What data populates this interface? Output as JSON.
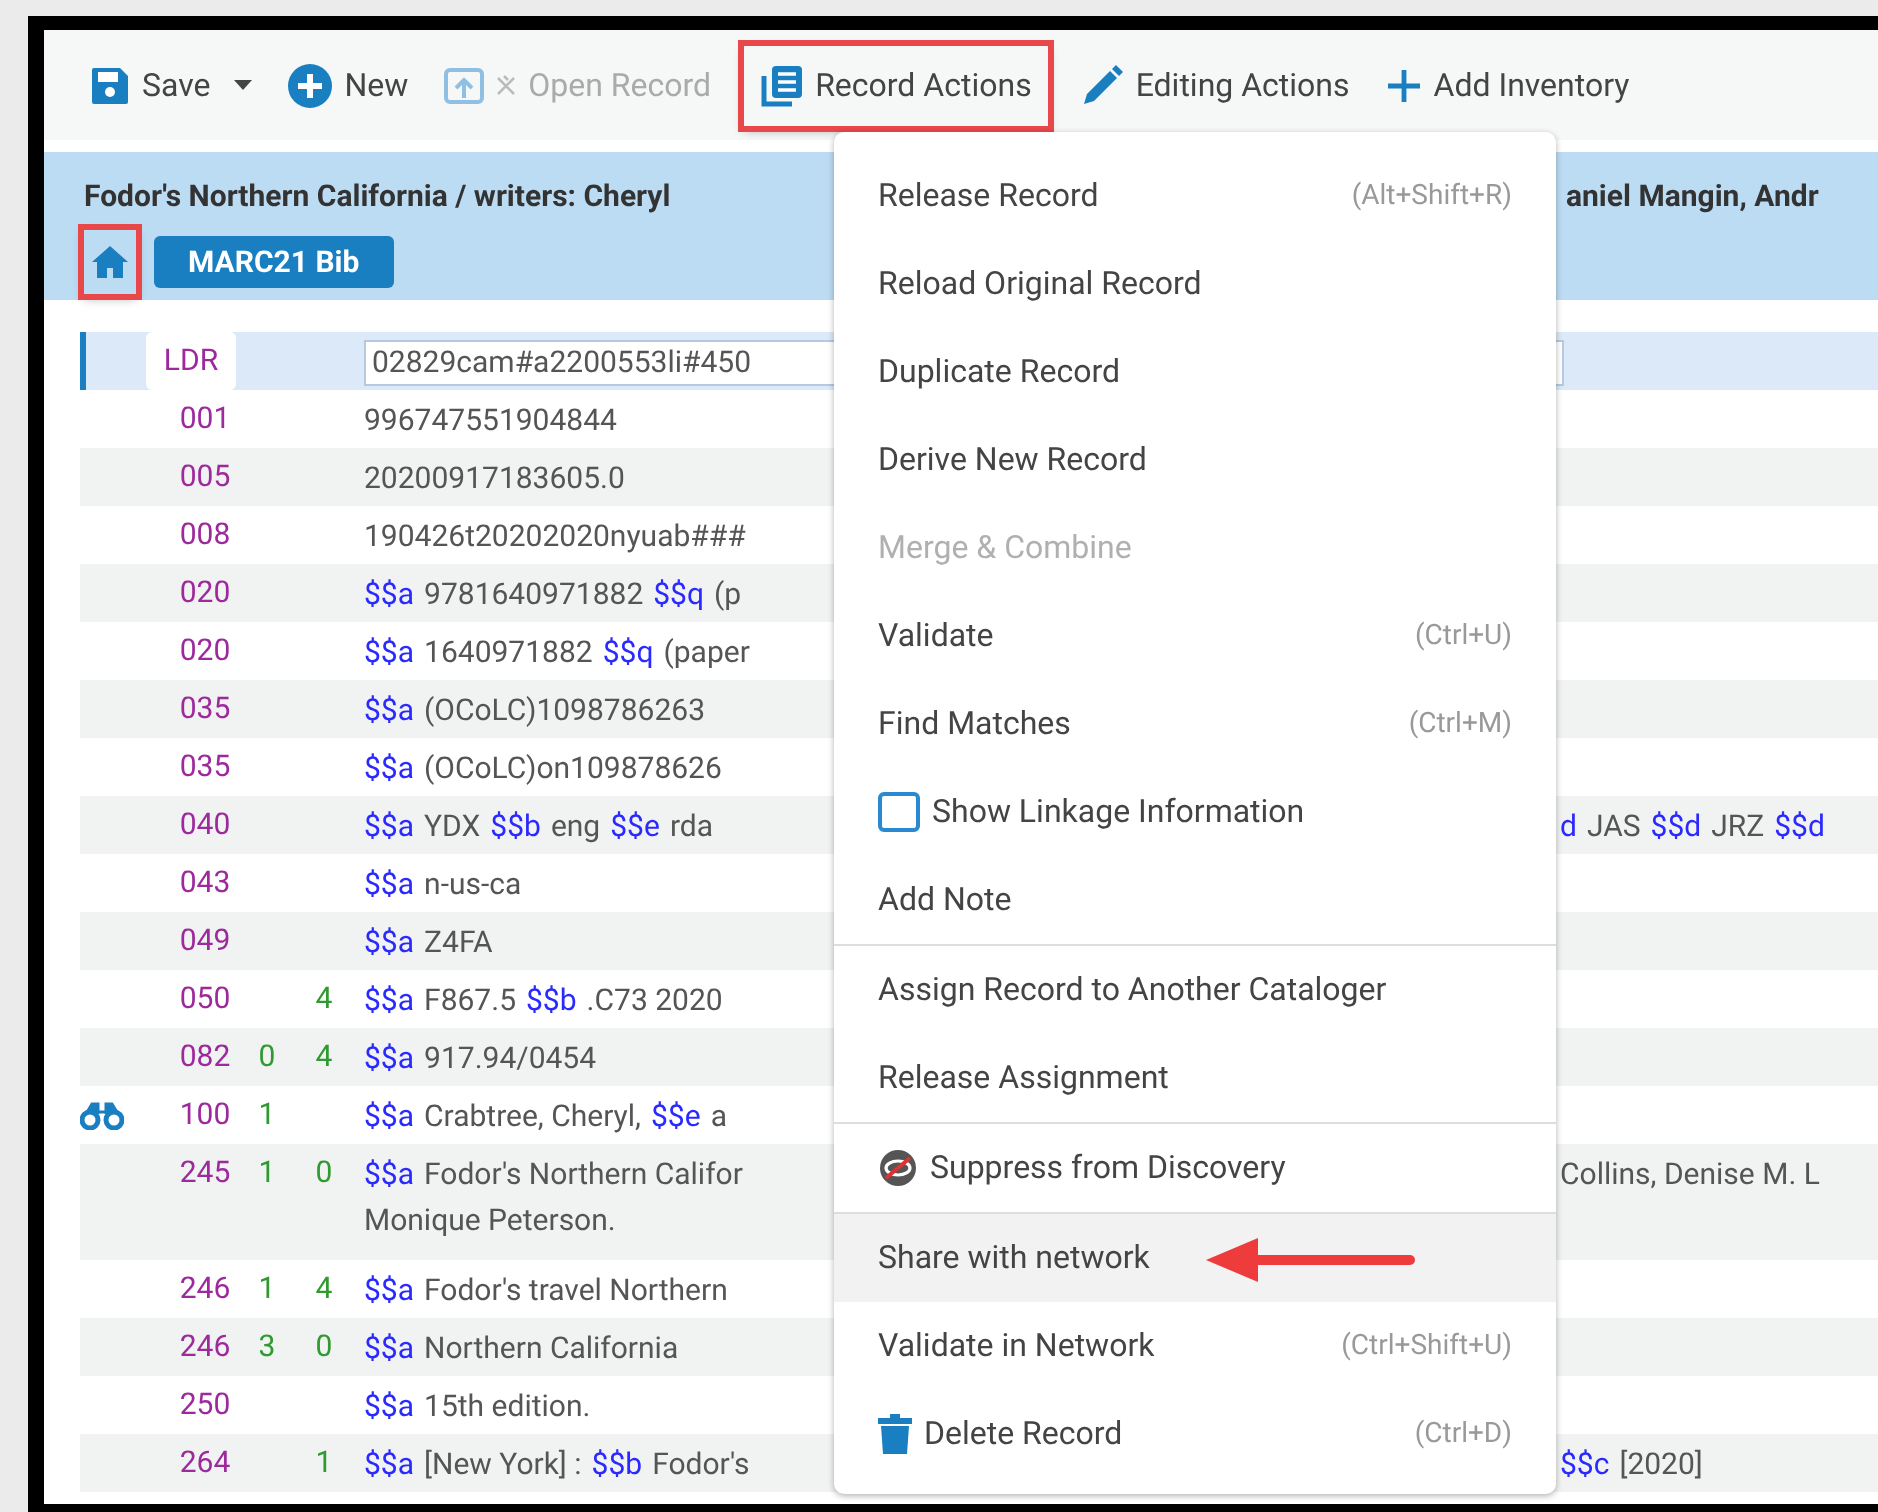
{
  "toolbar": [
    {
      "kind": "save",
      "label": "Save",
      "disabled": false,
      "framed": false
    },
    {
      "kind": "new",
      "label": "New",
      "disabled": false,
      "framed": false
    },
    {
      "kind": "open",
      "label": "Open Record",
      "disabled": true,
      "framed": false
    },
    {
      "kind": "record",
      "label": "Record Actions",
      "disabled": false,
      "framed": true
    },
    {
      "kind": "edit",
      "label": "Editing Actions",
      "disabled": false,
      "framed": false
    },
    {
      "kind": "add",
      "label": "Add Inventory",
      "disabled": false,
      "framed": false
    }
  ],
  "header": {
    "title_left": "Fodor's Northern California / writers: Cheryl",
    "title_right": "aniel Mangin, Andr",
    "home_framed": true,
    "badge": "MARC21 Bib"
  },
  "rows": [
    {
      "kind": "leader",
      "tag": "LDR",
      "ind1": "",
      "ind2": "",
      "selected": true,
      "linked": false,
      "value": "02829cam#a2200553li#450"
    },
    {
      "kind": "field",
      "tag": "001",
      "ind1": "",
      "ind2": "",
      "selected": false,
      "linked": false,
      "lines": [
        [
          {
            "kind": "text",
            "text": "996747551904844"
          }
        ]
      ]
    },
    {
      "kind": "field",
      "tag": "005",
      "ind1": "",
      "ind2": "",
      "selected": false,
      "linked": false,
      "lines": [
        [
          {
            "kind": "text",
            "text": "20200917183605.0"
          }
        ]
      ]
    },
    {
      "kind": "field",
      "tag": "008",
      "ind1": "",
      "ind2": "",
      "selected": false,
      "linked": false,
      "lines": [
        [
          {
            "kind": "text",
            "text": "190426t20202020nyuab###"
          }
        ]
      ]
    },
    {
      "kind": "field",
      "tag": "020",
      "ind1": "",
      "ind2": "",
      "selected": false,
      "linked": false,
      "lines": [
        [
          {
            "kind": "code",
            "text": "$$a"
          },
          {
            "kind": "text",
            "text": "9781640971882"
          },
          {
            "kind": "code",
            "text": "$$q"
          },
          {
            "kind": "text",
            "text": "(p"
          }
        ]
      ]
    },
    {
      "kind": "field",
      "tag": "020",
      "ind1": "",
      "ind2": "",
      "selected": false,
      "linked": false,
      "lines": [
        [
          {
            "kind": "code",
            "text": "$$a"
          },
          {
            "kind": "text",
            "text": "1640971882"
          },
          {
            "kind": "code",
            "text": "$$q"
          },
          {
            "kind": "text",
            "text": "(paper"
          }
        ]
      ]
    },
    {
      "kind": "field",
      "tag": "035",
      "ind1": "",
      "ind2": "",
      "selected": false,
      "linked": false,
      "lines": [
        [
          {
            "kind": "code",
            "text": "$$a"
          },
          {
            "kind": "text",
            "text": "(OCoLC)1098786263"
          }
        ]
      ]
    },
    {
      "kind": "field",
      "tag": "035",
      "ind1": "",
      "ind2": "",
      "selected": false,
      "linked": false,
      "lines": [
        [
          {
            "kind": "code",
            "text": "$$a"
          },
          {
            "kind": "text",
            "text": "(OCoLC)on109878626"
          }
        ]
      ]
    },
    {
      "kind": "field",
      "tag": "040",
      "ind1": "",
      "ind2": "",
      "selected": false,
      "linked": false,
      "lines": [
        [
          {
            "kind": "code",
            "text": "$$a"
          },
          {
            "kind": "text",
            "text": "YDX"
          },
          {
            "kind": "code",
            "text": "$$b"
          },
          {
            "kind": "text",
            "text": "eng"
          },
          {
            "kind": "code",
            "text": "$$e"
          },
          {
            "kind": "text",
            "text": "rda"
          }
        ]
      ],
      "right": [
        {
          "kind": "code",
          "text": "d"
        },
        {
          "kind": "text",
          "text": "JAS"
        },
        {
          "kind": "code",
          "text": "$$d"
        },
        {
          "kind": "text",
          "text": "JRZ"
        },
        {
          "kind": "code",
          "text": "$$d"
        }
      ]
    },
    {
      "kind": "field",
      "tag": "043",
      "ind1": "",
      "ind2": "",
      "selected": false,
      "linked": false,
      "lines": [
        [
          {
            "kind": "code",
            "text": "$$a"
          },
          {
            "kind": "text",
            "text": "n-us-ca"
          }
        ]
      ]
    },
    {
      "kind": "field",
      "tag": "049",
      "ind1": "",
      "ind2": "",
      "selected": false,
      "linked": false,
      "lines": [
        [
          {
            "kind": "code",
            "text": "$$a"
          },
          {
            "kind": "text",
            "text": "Z4FA"
          }
        ]
      ]
    },
    {
      "kind": "field",
      "tag": "050",
      "ind1": "",
      "ind2": "4",
      "selected": false,
      "linked": false,
      "lines": [
        [
          {
            "kind": "code",
            "text": "$$a"
          },
          {
            "kind": "text",
            "text": "F867.5"
          },
          {
            "kind": "code",
            "text": "$$b"
          },
          {
            "kind": "text",
            "text": ".C73 2020"
          }
        ]
      ]
    },
    {
      "kind": "field",
      "tag": "082",
      "ind1": "0",
      "ind2": "4",
      "selected": false,
      "linked": false,
      "lines": [
        [
          {
            "kind": "code",
            "text": "$$a"
          },
          {
            "kind": "text",
            "text": "917.94/0454"
          }
        ]
      ]
    },
    {
      "kind": "field",
      "tag": "100",
      "ind1": "1",
      "ind2": "",
      "selected": false,
      "linked": true,
      "lines": [
        [
          {
            "kind": "code",
            "text": "$$a"
          },
          {
            "kind": "text",
            "text": "Crabtree, Cheryl,"
          },
          {
            "kind": "code",
            "text": "$$e"
          },
          {
            "kind": "text",
            "text": "a"
          }
        ]
      ]
    },
    {
      "kind": "field",
      "tag": "245",
      "ind1": "1",
      "ind2": "0",
      "selected": false,
      "linked": false,
      "lines": [
        [
          {
            "kind": "code",
            "text": "$$a"
          },
          {
            "kind": "text",
            "text": "Fodor's Northern Califor"
          }
        ],
        [
          {
            "kind": "text",
            "text": "Monique Peterson."
          }
        ]
      ],
      "right": [
        {
          "kind": "text",
          "text": "Collins, Denise M. L"
        }
      ]
    },
    {
      "kind": "field",
      "tag": "246",
      "ind1": "1",
      "ind2": "4",
      "selected": false,
      "linked": false,
      "lines": [
        [
          {
            "kind": "code",
            "text": "$$a"
          },
          {
            "kind": "text",
            "text": "Fodor's travel Northern"
          }
        ]
      ]
    },
    {
      "kind": "field",
      "tag": "246",
      "ind1": "3",
      "ind2": "0",
      "selected": false,
      "linked": false,
      "lines": [
        [
          {
            "kind": "code",
            "text": "$$a"
          },
          {
            "kind": "text",
            "text": "Northern California"
          }
        ]
      ]
    },
    {
      "kind": "field",
      "tag": "250",
      "ind1": "",
      "ind2": "",
      "selected": false,
      "linked": false,
      "lines": [
        [
          {
            "kind": "code",
            "text": "$$a"
          },
          {
            "kind": "text",
            "text": "15th edition."
          }
        ]
      ]
    },
    {
      "kind": "field",
      "tag": "264",
      "ind1": "",
      "ind2": "1",
      "selected": false,
      "linked": false,
      "lines": [
        [
          {
            "kind": "code",
            "text": "$$a"
          },
          {
            "kind": "text",
            "text": "[New York] :"
          },
          {
            "kind": "code",
            "text": "$$b"
          },
          {
            "kind": "text",
            "text": "Fodor's"
          }
        ]
      ],
      "right": [
        {
          "kind": "code",
          "text": "$$c"
        },
        {
          "kind": "text",
          "text": "[2020]"
        }
      ]
    }
  ],
  "menu": [
    {
      "kind": "plain",
      "label": "Release Record",
      "shortcut": "(Alt+Shift+R)",
      "disabled": false,
      "highlighted": false,
      "pointed": false
    },
    {
      "kind": "plain",
      "label": "Reload Original Record",
      "disabled": false,
      "highlighted": false,
      "pointed": false
    },
    {
      "kind": "plain",
      "label": "Duplicate Record",
      "disabled": false,
      "highlighted": false,
      "pointed": false
    },
    {
      "kind": "plain",
      "label": "Derive New Record",
      "disabled": false,
      "highlighted": false,
      "pointed": false
    },
    {
      "kind": "plain",
      "label": "Merge & Combine",
      "disabled": true,
      "highlighted": false,
      "pointed": false
    },
    {
      "kind": "plain",
      "label": "Validate",
      "shortcut": "(Ctrl+U)",
      "disabled": false,
      "highlighted": false,
      "pointed": false
    },
    {
      "kind": "plain",
      "label": "Find Matches",
      "shortcut": "(Ctrl+M)",
      "disabled": false,
      "highlighted": false,
      "pointed": false
    },
    {
      "kind": "checkbox",
      "label": "Show Linkage Information",
      "checked": false,
      "disabled": false,
      "highlighted": false,
      "pointed": false
    },
    {
      "kind": "plain",
      "label": "Add Note",
      "disabled": false,
      "highlighted": false,
      "pointed": false
    },
    {
      "kind": "divider"
    },
    {
      "kind": "plain",
      "label": "Assign Record to Another Cataloger",
      "disabled": false,
      "highlighted": false,
      "pointed": false
    },
    {
      "kind": "plain",
      "label": "Release Assignment",
      "disabled": false,
      "highlighted": false,
      "pointed": false
    },
    {
      "kind": "divider"
    },
    {
      "kind": "suppress",
      "label": "Suppress from Discovery",
      "disabled": false,
      "highlighted": false,
      "pointed": false
    },
    {
      "kind": "divider"
    },
    {
      "kind": "plain",
      "label": "Share with network",
      "disabled": false,
      "highlighted": true,
      "pointed": true
    },
    {
      "kind": "plain",
      "label": "Validate in Network",
      "shortcut": "(Ctrl+Shift+U)",
      "disabled": false,
      "highlighted": false,
      "pointed": false
    },
    {
      "kind": "delete",
      "label": "Delete Record",
      "shortcut": "(Ctrl+D)",
      "disabled": false,
      "highlighted": false,
      "pointed": false
    }
  ]
}
